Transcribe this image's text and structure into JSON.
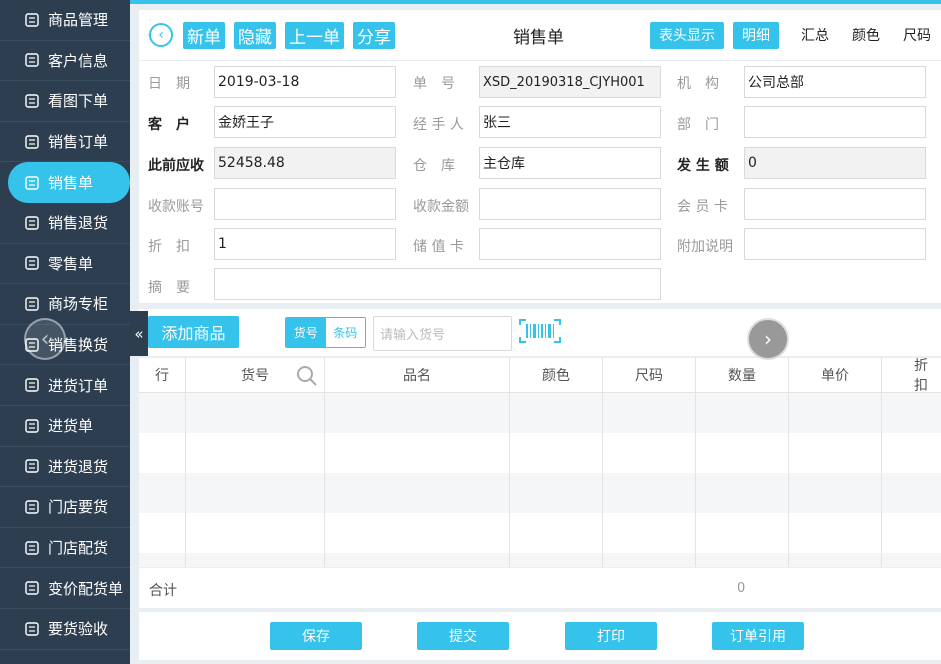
{
  "sidebar": {
    "items": [
      {
        "label": "商品管理",
        "icon": "box-icon"
      },
      {
        "label": "客户信息",
        "icon": "user-icon"
      },
      {
        "label": "看图下单",
        "icon": "image-icon"
      },
      {
        "label": "销售订单",
        "icon": "order-icon"
      },
      {
        "label": "销售单",
        "icon": "sale-icon"
      },
      {
        "label": "销售退货",
        "icon": "return-icon"
      },
      {
        "label": "零售单",
        "icon": "receipt-icon"
      },
      {
        "label": "商场专柜",
        "icon": "bag-icon"
      },
      {
        "label": "销售换货",
        "icon": "exchange-icon"
      },
      {
        "label": "进货订单",
        "icon": "purchase-order-icon"
      },
      {
        "label": "进货单",
        "icon": "purchase-icon"
      },
      {
        "label": "进货退货",
        "icon": "purchase-return-icon"
      },
      {
        "label": "门店要货",
        "icon": "store-request-icon"
      },
      {
        "label": "门店配货",
        "icon": "store-distribute-icon"
      },
      {
        "label": "变价配货单",
        "icon": "price-change-icon"
      },
      {
        "label": "要货验收",
        "icon": "inspect-icon"
      }
    ],
    "active_index": 4
  },
  "toolbar": {
    "new": "新单",
    "hide": "隐藏",
    "prev": "上一单",
    "share": "分享",
    "title": "销售单",
    "header_display": "表头显示",
    "detail": "明细",
    "summary": "汇总",
    "color": "颜色",
    "size": "尺码"
  },
  "form": {
    "date_label": "日　期",
    "date": "2019-03-18",
    "no_label": "单　号",
    "no": "XSD_20190318_CJYH001",
    "org_label": "机　构",
    "org": "公司总部",
    "customer_label": "客　户",
    "customer": "金娇王子",
    "handler_label": "经 手 人",
    "handler": "张三",
    "dept_label": "部　门",
    "dept": "",
    "prev_receivable_label": "此前应收",
    "prev_receivable": "52458.48",
    "warehouse_label": "仓　库",
    "warehouse": "主仓库",
    "amount_label": "发 生 额",
    "amount": "0",
    "account_label": "收款账号",
    "account": "",
    "receipt_label": "收款金额",
    "receipt": "",
    "member_label": "会 员 卡",
    "member": "",
    "discount_label": "折　扣",
    "discount": "1",
    "stored_label": "储 值 卡",
    "stored": "",
    "note_label": "附加说明",
    "note": "",
    "summary_label": "摘　要",
    "summary": ""
  },
  "goods": {
    "add": "添加商品",
    "seg_on": "货号",
    "seg_off": "条码",
    "placeholder": "请输入货号"
  },
  "table": {
    "headers": [
      "行",
      "货号",
      "品名",
      "颜色",
      "尺码",
      "数量",
      "单价",
      "折扣"
    ],
    "total_label": "合计",
    "total_qty": "0"
  },
  "actions": {
    "save": "保存",
    "submit": "提交",
    "print": "打印",
    "order_ref": "订单引用"
  },
  "colors": {
    "accent": "#35c3ec",
    "sidebar": "#2d3e50"
  }
}
